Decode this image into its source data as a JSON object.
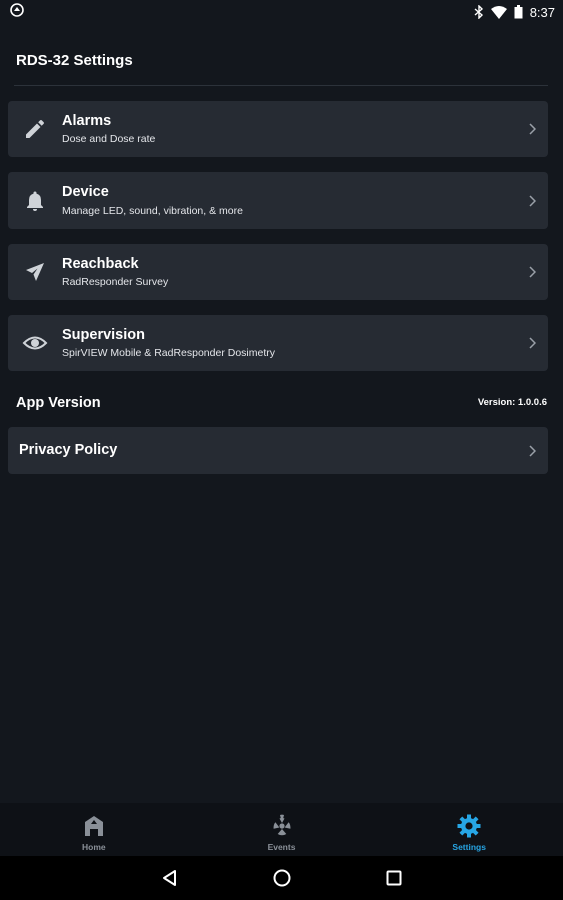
{
  "status_bar": {
    "time": "8:37",
    "icons": [
      "app-notification-icon",
      "bluetooth-icon",
      "wifi-icon",
      "battery-icon"
    ]
  },
  "page": {
    "title": "RDS-32 Settings"
  },
  "menu": [
    {
      "id": "alarms",
      "icon": "pencil-icon",
      "title": "Alarms",
      "subtitle": "Dose and Dose rate"
    },
    {
      "id": "device",
      "icon": "bell-icon",
      "title": "Device",
      "subtitle": "Manage LED, sound, vibration, & more"
    },
    {
      "id": "reachback",
      "icon": "paper-plane-icon",
      "title": "Reachback",
      "subtitle": "RadResponder Survey"
    },
    {
      "id": "supervision",
      "icon": "eye-icon",
      "title": "Supervision",
      "subtitle": "SpirVIEW Mobile & RadResponder Dosimetry"
    }
  ],
  "app_version": {
    "label": "App Version",
    "value": "Version: 1.0.0.6"
  },
  "privacy": {
    "label": "Privacy Policy"
  },
  "bottom_nav": {
    "items": [
      {
        "label": "Home",
        "icon": "home-icon",
        "active": false
      },
      {
        "label": "Events",
        "icon": "radiation-icon",
        "active": false
      },
      {
        "label": "Settings",
        "icon": "gear-icon",
        "active": true
      }
    ]
  },
  "colors": {
    "background": "#13171d",
    "card": "#262b33",
    "accent": "#27a6e5",
    "inactive": "#8a9098"
  }
}
